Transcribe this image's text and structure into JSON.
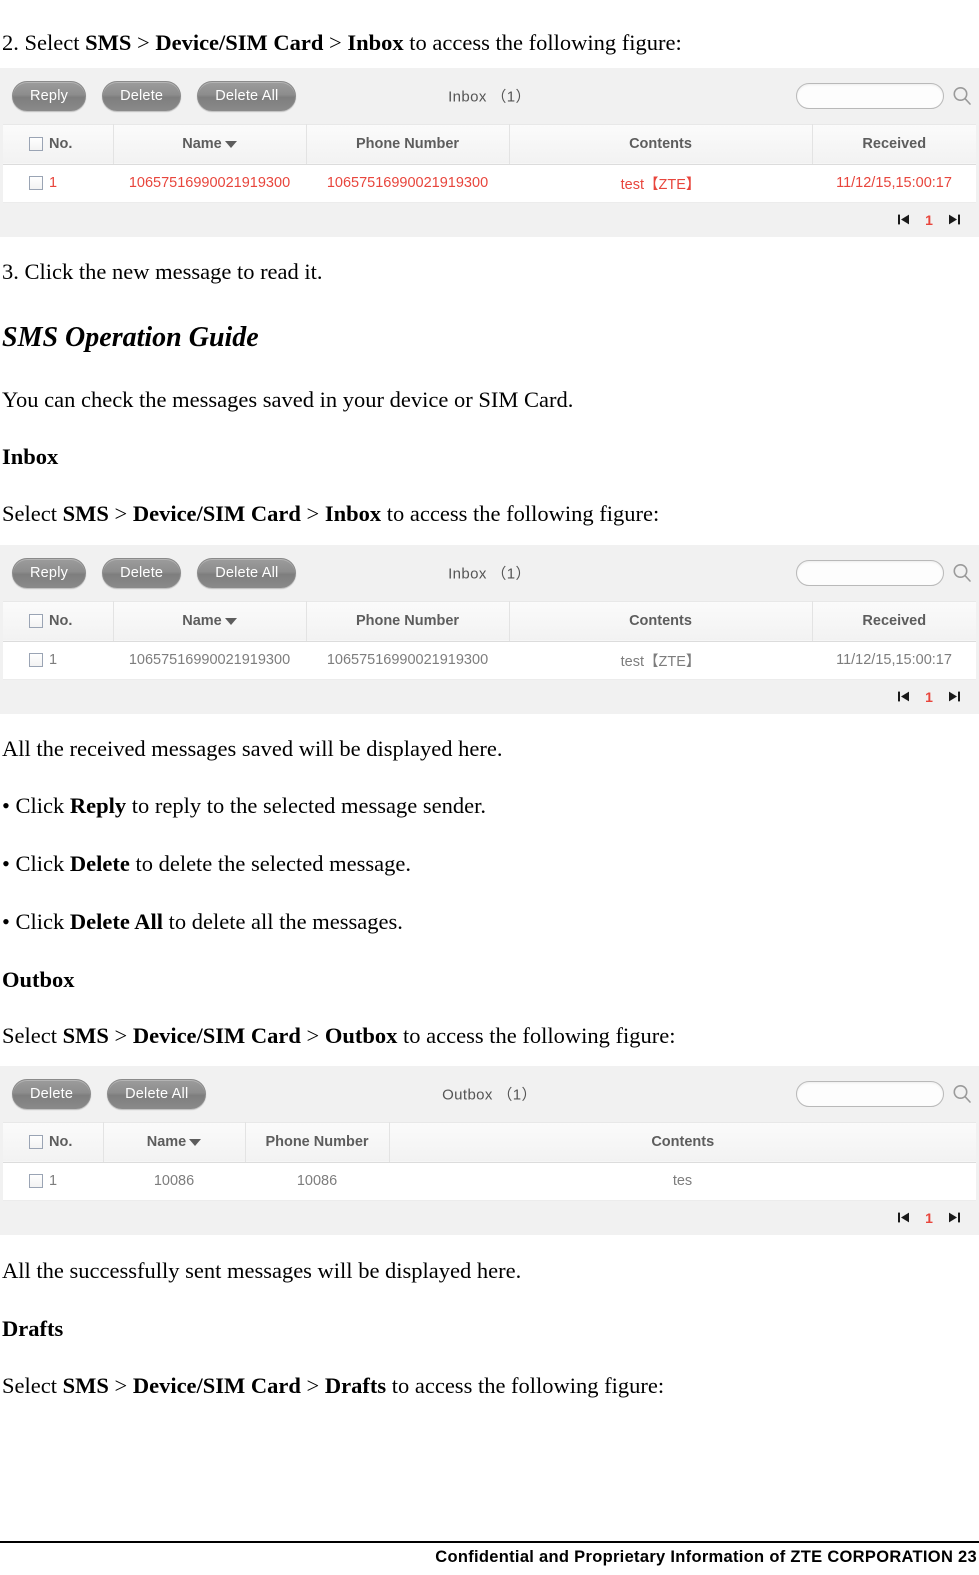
{
  "doc": {
    "step2": {
      "prefix": "2. Select ",
      "b1": "SMS",
      "sep1": " > ",
      "b2": "Device/SIM Card",
      "sep2": " > ",
      "b3": "Inbox",
      "suffix": " to access the following figure:"
    },
    "step3": "3. Click the new message to read it.",
    "section_heading": "SMS Operation Guide",
    "intro": "You can check the messages saved in your device or SIM Card.",
    "inbox_heading": "Inbox",
    "select_inbox": {
      "prefix": "Select ",
      "b1": "SMS",
      "sep1": " > ",
      "b2": "Device/SIM Card",
      "sep2": " > ",
      "b3": "Inbox",
      "suffix": " to access the following figure:"
    },
    "received_note": "All the received messages saved will be displayed here.",
    "bullet_reply": {
      "prefix": "• Click ",
      "bold": "Reply",
      "suffix": " to reply to the selected message sender."
    },
    "bullet_delete": {
      "prefix": "• Click ",
      "bold": "Delete",
      "suffix": " to delete the selected message."
    },
    "bullet_delete_all": {
      "prefix": "• Click ",
      "bold": "Delete All",
      "suffix": " to delete all the messages."
    },
    "outbox_heading": "Outbox",
    "select_outbox": {
      "prefix": "Select ",
      "b1": "SMS",
      "sep1": " > ",
      "b2": "Device/SIM Card",
      "sep2": " > ",
      "b3": "Outbox",
      "suffix": " to access the following figure:"
    },
    "sent_note": "All the successfully sent messages will be displayed here.",
    "drafts_heading": "Drafts",
    "select_drafts": {
      "prefix": "Select ",
      "b1": "SMS",
      "sep1": " > ",
      "b2": "Device/SIM Card",
      "sep2": " > ",
      "b3": "Drafts",
      "suffix": " to access the following figure:"
    }
  },
  "footer": {
    "text": "Confidential and Proprietary Information of ZTE CORPORATION 23"
  },
  "figure1": {
    "buttons": [
      "Reply",
      "Delete",
      "Delete All"
    ],
    "title": "Inbox （1）",
    "search_placeholder": "",
    "search_value": "",
    "search_icon": "search-icon",
    "columns": [
      "No.",
      "Name",
      "Phone Number",
      "Contents",
      "Received"
    ],
    "rows": [
      {
        "no": "1",
        "name": "10657516990021919300",
        "phone": "10657516990021919300",
        "contents": "test【ZTE】",
        "received": "11/12/15,15:00:17"
      }
    ],
    "pager": {
      "first_icon": "first-page-icon",
      "page": "1",
      "last_icon": "last-page-icon"
    },
    "text_color": "#e8453c"
  },
  "figure2": {
    "buttons": [
      "Reply",
      "Delete",
      "Delete All"
    ],
    "title": "Inbox （1）",
    "search_placeholder": "",
    "search_value": "",
    "search_icon": "search-icon",
    "columns": [
      "No.",
      "Name",
      "Phone Number",
      "Contents",
      "Received"
    ],
    "rows": [
      {
        "no": "1",
        "name": "10657516990021919300",
        "phone": "10657516990021919300",
        "contents": "test【ZTE】",
        "received": "11/12/15,15:00:17"
      }
    ],
    "pager": {
      "first_icon": "first-page-icon",
      "page": "1",
      "last_icon": "last-page-icon"
    },
    "text_color": "#7d7d7d"
  },
  "figure3": {
    "buttons": [
      "Delete",
      "Delete All"
    ],
    "title": "Outbox （1）",
    "search_placeholder": "",
    "search_value": "",
    "search_icon": "search-icon",
    "columns": [
      "No.",
      "Name",
      "Phone Number",
      "Contents"
    ],
    "rows": [
      {
        "no": "1",
        "name": "10086",
        "phone": "10086",
        "contents": "tes"
      }
    ],
    "pager": {
      "first_icon": "first-page-icon",
      "page": "1",
      "last_icon": "last-page-icon"
    },
    "text_color": "#7d7d7d"
  }
}
